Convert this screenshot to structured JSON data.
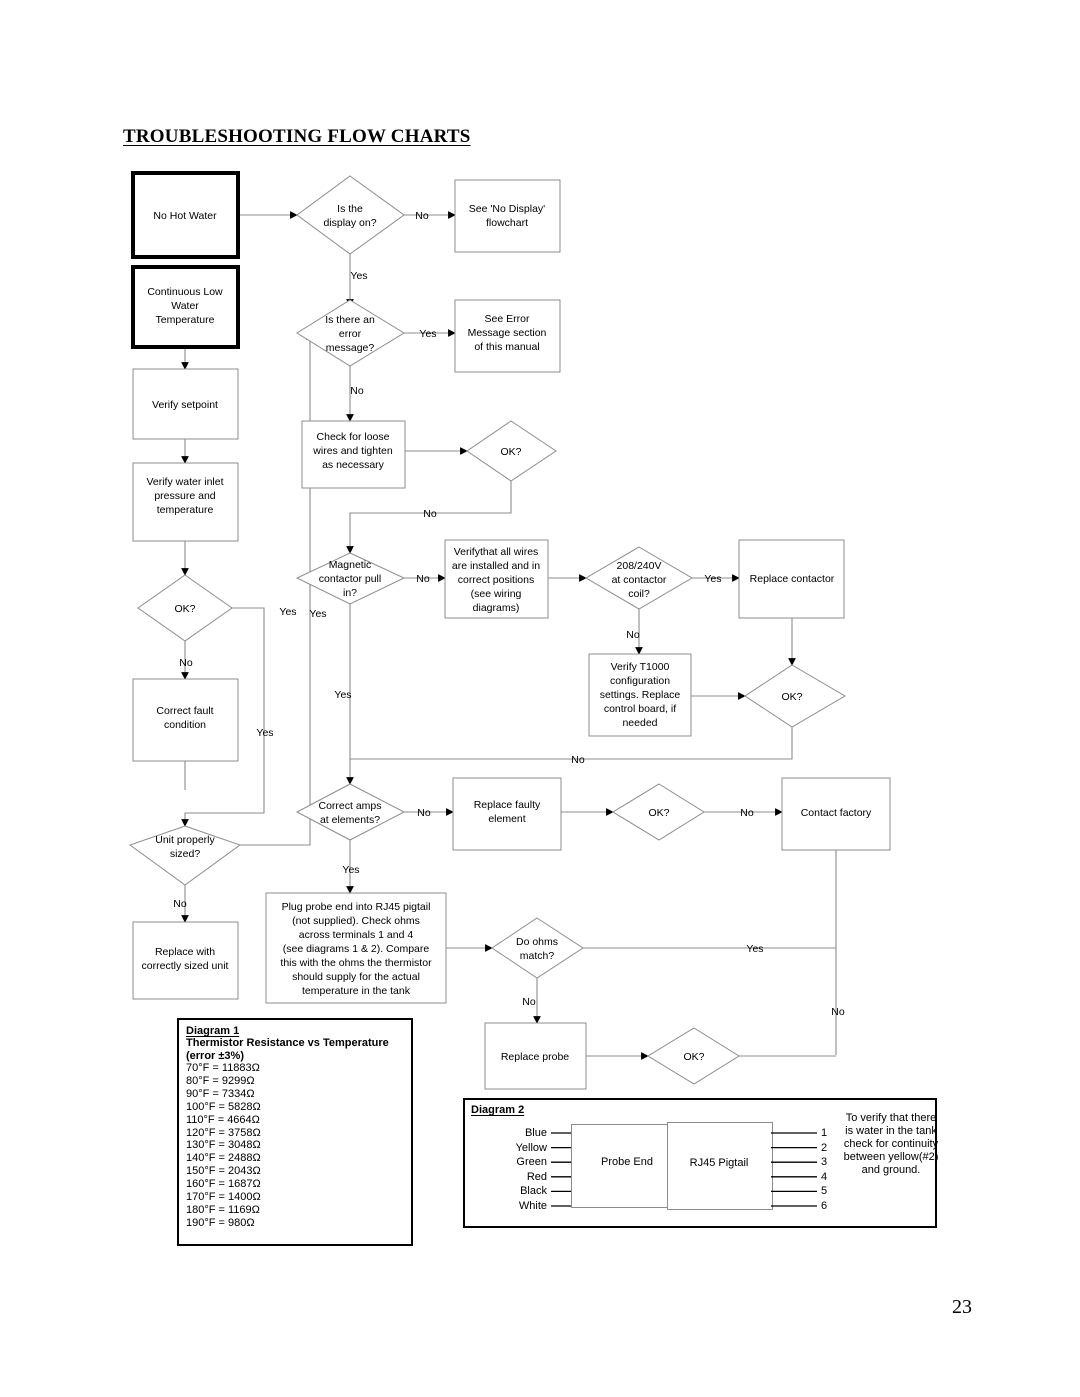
{
  "page": {
    "title": "TROUBLESHOOTING FLOW CHARTS",
    "number": "23"
  },
  "flowchart": {
    "nodes": {
      "no_hot_water": "No Hot Water",
      "continuous_low": "Continuous Low\nWater\nTemperature",
      "verify_setpoint": "Verify setpoint",
      "verify_inlet": "Verify water inlet\npressure and\ntemperature",
      "ok1": "OK?",
      "correct_fault": "Correct fault\ncondition",
      "unit_sized": "Unit properly\nsized?",
      "replace_unit": "Replace with\ncorrectly sized unit",
      "display_on": "Is the\ndisplay on?",
      "no_display": "See 'No Display'\nflowchart",
      "error_message": "Is there an\nerror\nmessage?",
      "see_error": "See Error\nMessage section\nof this manual",
      "check_wires": "Check for loose\nwires and tighten\nas necessary",
      "ok2": "OK?",
      "magnetic": "Magnetic\ncontactor pull\nin?",
      "verify_wires": "Verifythat all wires\nare installed and in\ncorrect positions\n(see wiring\ndiagrams)",
      "voltage": "208/240V\nat contactor\ncoil?",
      "replace_contactor": "Replace contactor",
      "verify_t1000": "Verify T1000\nconfiguration\nsettings. Replace\ncontrol board, if\nneeded",
      "ok3": "OK?",
      "correct_amps": "Correct amps\nat elements?",
      "replace_element": "Replace faulty\nelement",
      "ok4": "OK?",
      "contact_factory": "Contact factory",
      "plug_probe": "Plug probe end into RJ45 pigtail\n(not supplied). Check ohms\nacross terminals 1 and 4\n(see diagrams 1 & 2). Compare\nthis with the ohms the thermistor\nshould supply for the actual\ntemperature in the tank",
      "do_ohms": "Do ohms\nmatch?",
      "replace_probe": "Replace probe",
      "ok5": "OK?"
    },
    "edge_labels": {
      "display_no": "No",
      "display_yes": "Yes",
      "error_yes": "Yes",
      "error_no": "No",
      "ok2_no": "No",
      "magnetic_no": "No",
      "magnetic_yes": "Yes",
      "voltage_yes": "Yes",
      "voltage_no": "No",
      "ok3_no": "No",
      "ok1_no": "No",
      "ok1_yes": "Yes",
      "fault_yes": "Yes",
      "unit_yes": "Yes",
      "unit_no": "No",
      "amps_no": "No",
      "amps_yes": "Yes",
      "ok4_no": "No",
      "ohms_yes": "Yes",
      "ohms_no": "No",
      "ok5_no": "No"
    }
  },
  "diagram1": {
    "title": "Diagram 1",
    "subtitle": "Thermistor Resistance vs Temperature",
    "error_note": "(error ±3%)",
    "rows": [
      "70°F = 11883Ω",
      "80°F = 9299Ω",
      "90°F = 7334Ω",
      "100°F = 5828Ω",
      "110°F = 4664Ω",
      "120°F = 3758Ω",
      "130°F = 3048Ω",
      "140°F = 2488Ω",
      "150°F = 2043Ω",
      "160°F = 1687Ω",
      "170°F = 1400Ω",
      "180°F = 1169Ω",
      "190°F = 980Ω"
    ]
  },
  "diagram2": {
    "title": "Diagram 2",
    "wires": [
      "Blue",
      "Yellow",
      "Green",
      "Red",
      "Black",
      "White"
    ],
    "pins": [
      "1",
      "2",
      "3",
      "4",
      "5",
      "6"
    ],
    "probe_label": "Probe End",
    "rj45_label": "RJ45 Pigtail",
    "note": "To verify that there is water in the tank check for continuity between yellow(#2) and ground."
  }
}
